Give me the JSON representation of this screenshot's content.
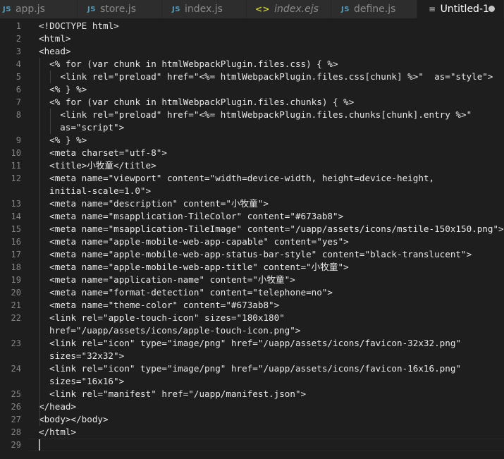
{
  "tabs": [
    {
      "label": "app.js",
      "icon": "js-file-icon",
      "icon_text": "JS",
      "italic": false,
      "active": false
    },
    {
      "label": "store.js",
      "icon": "js-file-icon",
      "icon_text": "JS",
      "italic": false,
      "active": false
    },
    {
      "label": "index.js",
      "icon": "js-file-icon",
      "icon_text": "JS",
      "italic": false,
      "active": false
    },
    {
      "label": "index.ejs",
      "icon": "code-file-icon",
      "icon_text": "<>",
      "italic": true,
      "active": false
    },
    {
      "label": "define.js",
      "icon": "js-file-icon",
      "icon_text": "JS",
      "italic": false,
      "active": false
    },
    {
      "label": "Untitled-1",
      "icon": "text-file-icon",
      "icon_text": "≡",
      "italic": false,
      "active": true,
      "dirty": true
    }
  ],
  "editor": {
    "lines": [
      {
        "number": "1",
        "text": "<!DOCTYPE html>"
      },
      {
        "number": "2",
        "text": "<html>"
      },
      {
        "number": "3",
        "text": "<head>"
      },
      {
        "number": "4",
        "text": "  <% for (var chunk in htmlWebpackPlugin.files.css) { %>"
      },
      {
        "number": "5",
        "text": "    <link rel=\"preload\" href=\"<%= htmlWebpackPlugin.files.css[chunk] %>\"  as=\"style\">"
      },
      {
        "number": "6",
        "text": "  <% } %>"
      },
      {
        "number": "7",
        "text": "  <% for (var chunk in htmlWebpackPlugin.files.chunks) { %>"
      },
      {
        "number": "8",
        "text": "    <link rel=\"preload\" href=\"<%= htmlWebpackPlugin.files.chunks[chunk].entry %>\"",
        "wrap": "  as=\"script\">"
      },
      {
        "number": "9",
        "text": "  <% } %>"
      },
      {
        "number": "10",
        "text": "  <meta charset=\"utf-8\">"
      },
      {
        "number": "11",
        "text": "  <title>小牧童</title>"
      },
      {
        "number": "12",
        "text": "  <meta name=\"viewport\" content=\"width=device-width, height=device-height,",
        "wrap": "initial-scale=1.0\">"
      },
      {
        "number": "13",
        "text": "  <meta name=\"description\" content=\"小牧童\">"
      },
      {
        "number": "14",
        "text": "  <meta name=\"msapplication-TileColor\" content=\"#673ab8\">"
      },
      {
        "number": "15",
        "text": "  <meta name=\"msapplication-TileImage\" content=\"/uapp/assets/icons/mstile-150x150.png\">"
      },
      {
        "number": "16",
        "text": "  <meta name=\"apple-mobile-web-app-capable\" content=\"yes\">"
      },
      {
        "number": "17",
        "text": "  <meta name=\"apple-mobile-web-app-status-bar-style\" content=\"black-translucent\">"
      },
      {
        "number": "18",
        "text": "  <meta name=\"apple-mobile-web-app-title\" content=\"小牧童\">"
      },
      {
        "number": "19",
        "text": "  <meta name=\"application-name\" content=\"小牧童\">"
      },
      {
        "number": "20",
        "text": "  <meta name=\"format-detection\" content=\"telephone=no\">"
      },
      {
        "number": "21",
        "text": "  <meta name=\"theme-color\" content=\"#673ab8\">"
      },
      {
        "number": "22",
        "text": "  <link rel=\"apple-touch-icon\" sizes=\"180x180\"",
        "wrap": "href=\"/uapp/assets/icons/apple-touch-icon.png\">"
      },
      {
        "number": "23",
        "text": "  <link rel=\"icon\" type=\"image/png\" href=\"/uapp/assets/icons/favicon-32x32.png\"",
        "wrap": "sizes=\"32x32\">"
      },
      {
        "number": "24",
        "text": "  <link rel=\"icon\" type=\"image/png\" href=\"/uapp/assets/icons/favicon-16x16.png\"",
        "wrap": "sizes=\"16x16\">"
      },
      {
        "number": "25",
        "text": "  <link rel=\"manifest\" href=\"/uapp/manifest.json\">"
      },
      {
        "number": "26",
        "text": "</head>"
      },
      {
        "number": "27",
        "text": "<body></body>"
      },
      {
        "number": "28",
        "text": "</html>"
      },
      {
        "number": "29",
        "text": ""
      }
    ]
  },
  "colors": {
    "background": "#1e1e1e",
    "tab_inactive": "#2d2d2d",
    "line_number": "#858585",
    "text": "#e8e8e8"
  }
}
